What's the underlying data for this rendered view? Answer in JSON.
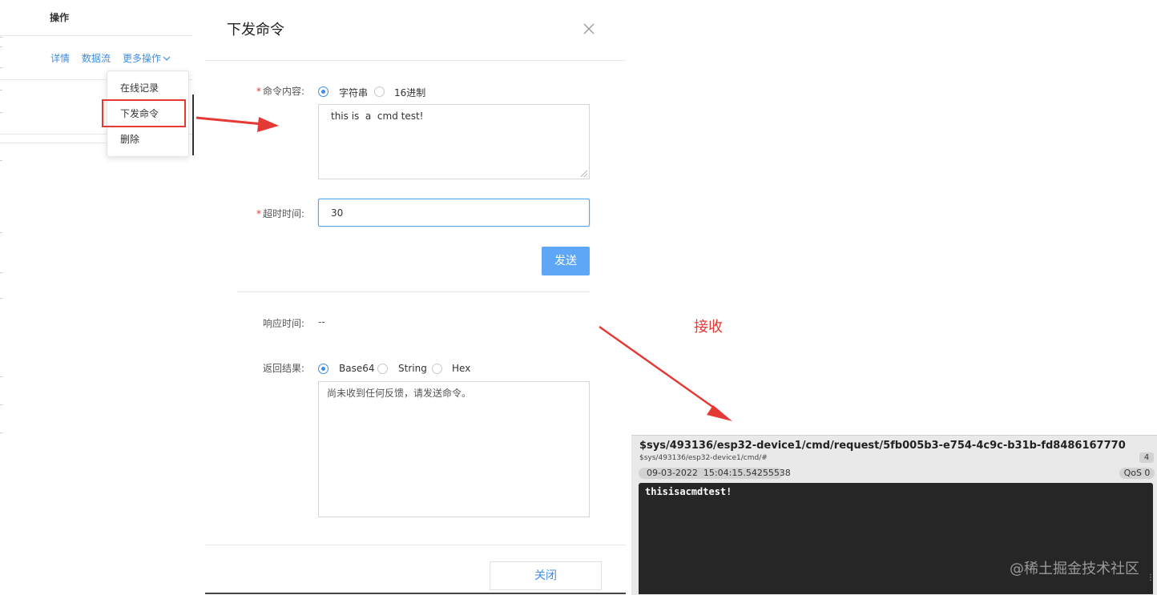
{
  "left_table": {
    "header": "操作",
    "row_actions": {
      "detail": "详情",
      "datastream": "数据流",
      "more": "更多操作",
      "more_icon": "chevron-down-icon"
    },
    "dropdown": {
      "items": [
        "在线记录",
        "下发命令",
        "删除"
      ],
      "highlighted": "下发命令"
    }
  },
  "modal": {
    "title": "下发命令",
    "close_icon": "close-icon",
    "command": {
      "label": "命令内容:",
      "required_mark": "*",
      "types": [
        "字符串",
        "16进制"
      ],
      "selected_type": "字符串",
      "value": "this is  a  cmd test!"
    },
    "timeout": {
      "label": "超时时间:",
      "required_mark": "*",
      "value": "30"
    },
    "send_button": "发送",
    "response_time": {
      "label": "响应时间:",
      "value": "--"
    },
    "result": {
      "label": "返回结果:",
      "formats": [
        "Base64",
        "String",
        "Hex"
      ],
      "selected_format": "Base64",
      "value": "尚未收到任何反馈，请发送命令。"
    },
    "close_button": "关闭"
  },
  "annotation": {
    "receive_label": "接收",
    "arrow_color": "#e53935"
  },
  "mqtt_message": {
    "topic": "$sys/493136/esp32-device1/cmd/request/5fb005b3-e754-4c9c-b31b-fd8486167770",
    "subscription": "$sys/493136/esp32-device1/cmd/#",
    "count": "4",
    "timestamp": "09-03-2022  15:04:15.54255538",
    "qos": "QoS 0",
    "payload": "thisisacmdtest!"
  },
  "watermark": "@稀土掘金技术社区",
  "colors": {
    "primary": "#3d8ee6",
    "primary_button": "#5ea7f7",
    "accent_red": "#e53935",
    "terminal_bg": "#262626"
  }
}
